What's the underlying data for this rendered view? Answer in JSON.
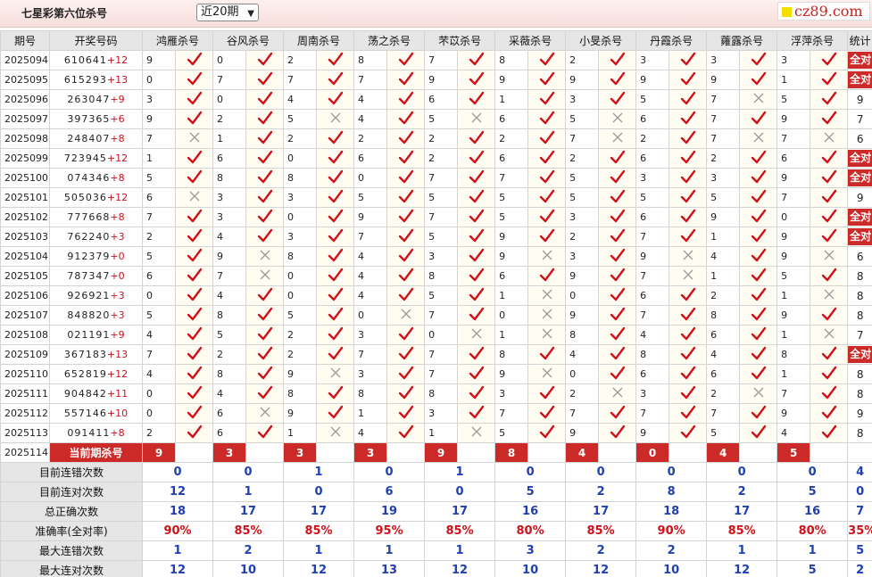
{
  "header": {
    "title": "七星彩第六位杀号",
    "period_selected": "近20期",
    "logo_text": "cz89.com"
  },
  "table": {
    "col_period": "期号",
    "col_draw": "开奖号码",
    "col_stat": "统计",
    "experts": [
      "鸿雁杀号",
      "谷风杀号",
      "周南杀号",
      "荡之杀号",
      "芣苡杀号",
      "采薇杀号",
      "小旻杀号",
      "丹霞杀号",
      "蕹露杀号",
      "浮萍杀号"
    ],
    "rows": [
      {
        "period": "2025094",
        "digits": "610641",
        "sum": "+12",
        "kills": [
          "9",
          "0",
          "2",
          "8",
          "7",
          "8",
          "2",
          "3",
          "3",
          "3"
        ],
        "hits": [
          1,
          1,
          1,
          1,
          1,
          1,
          1,
          1,
          1,
          1
        ],
        "stat": "全对"
      },
      {
        "period": "2025095",
        "digits": "615293",
        "sum": "+13",
        "kills": [
          "0",
          "7",
          "7",
          "7",
          "9",
          "9",
          "9",
          "9",
          "9",
          "1"
        ],
        "hits": [
          1,
          1,
          1,
          1,
          1,
          1,
          1,
          1,
          1,
          1
        ],
        "stat": "全对"
      },
      {
        "period": "2025096",
        "digits": "263047",
        "sum": "+9",
        "kills": [
          "3",
          "0",
          "4",
          "4",
          "6",
          "1",
          "3",
          "5",
          "7",
          "5"
        ],
        "hits": [
          1,
          1,
          1,
          1,
          1,
          1,
          1,
          1,
          0,
          1
        ],
        "stat": "9"
      },
      {
        "period": "2025097",
        "digits": "397365",
        "sum": "+6",
        "kills": [
          "9",
          "2",
          "5",
          "4",
          "5",
          "6",
          "5",
          "6",
          "7",
          "9"
        ],
        "hits": [
          1,
          1,
          0,
          1,
          0,
          1,
          0,
          1,
          1,
          1
        ],
        "stat": "7"
      },
      {
        "period": "2025098",
        "digits": "248407",
        "sum": "+8",
        "kills": [
          "7",
          "1",
          "2",
          "2",
          "2",
          "2",
          "7",
          "2",
          "7",
          "7"
        ],
        "hits": [
          0,
          1,
          1,
          1,
          1,
          1,
          0,
          1,
          0,
          0
        ],
        "stat": "6"
      },
      {
        "period": "2025099",
        "digits": "723945",
        "sum": "+12",
        "kills": [
          "1",
          "6",
          "0",
          "6",
          "2",
          "6",
          "2",
          "6",
          "2",
          "6"
        ],
        "hits": [
          1,
          1,
          1,
          1,
          1,
          1,
          1,
          1,
          1,
          1
        ],
        "stat": "全对"
      },
      {
        "period": "2025100",
        "digits": "074346",
        "sum": "+8",
        "kills": [
          "5",
          "8",
          "8",
          "0",
          "7",
          "7",
          "5",
          "3",
          "3",
          "9"
        ],
        "hits": [
          1,
          1,
          1,
          1,
          1,
          1,
          1,
          1,
          1,
          1
        ],
        "stat": "全对"
      },
      {
        "period": "2025101",
        "digits": "505036",
        "sum": "+12",
        "kills": [
          "6",
          "3",
          "3",
          "5",
          "5",
          "5",
          "5",
          "5",
          "5",
          "7"
        ],
        "hits": [
          0,
          1,
          1,
          1,
          1,
          1,
          1,
          1,
          1,
          1
        ],
        "stat": "9"
      },
      {
        "period": "2025102",
        "digits": "777668",
        "sum": "+8",
        "kills": [
          "7",
          "3",
          "0",
          "9",
          "7",
          "5",
          "3",
          "6",
          "9",
          "0"
        ],
        "hits": [
          1,
          1,
          1,
          1,
          1,
          1,
          1,
          1,
          1,
          1
        ],
        "stat": "全对"
      },
      {
        "period": "2025103",
        "digits": "762240",
        "sum": "+3",
        "kills": [
          "2",
          "4",
          "3",
          "7",
          "5",
          "9",
          "2",
          "7",
          "1",
          "9"
        ],
        "hits": [
          1,
          1,
          1,
          1,
          1,
          1,
          1,
          1,
          1,
          1
        ],
        "stat": "全对"
      },
      {
        "period": "2025104",
        "digits": "912379",
        "sum": "+0",
        "kills": [
          "5",
          "9",
          "8",
          "4",
          "3",
          "9",
          "3",
          "9",
          "4",
          "9"
        ],
        "hits": [
          1,
          0,
          1,
          1,
          1,
          0,
          1,
          0,
          1,
          0
        ],
        "stat": "6"
      },
      {
        "period": "2025105",
        "digits": "787347",
        "sum": "+0",
        "kills": [
          "6",
          "7",
          "0",
          "4",
          "8",
          "6",
          "9",
          "7",
          "1",
          "5"
        ],
        "hits": [
          1,
          0,
          1,
          1,
          1,
          1,
          1,
          0,
          1,
          1
        ],
        "stat": "8"
      },
      {
        "period": "2025106",
        "digits": "926921",
        "sum": "+3",
        "kills": [
          "0",
          "4",
          "0",
          "4",
          "5",
          "1",
          "0",
          "6",
          "2",
          "1"
        ],
        "hits": [
          1,
          1,
          1,
          1,
          1,
          0,
          1,
          1,
          1,
          0
        ],
        "stat": "8"
      },
      {
        "period": "2025107",
        "digits": "848820",
        "sum": "+3",
        "kills": [
          "5",
          "8",
          "5",
          "0",
          "7",
          "0",
          "9",
          "7",
          "8",
          "9"
        ],
        "hits": [
          1,
          1,
          1,
          0,
          1,
          0,
          1,
          1,
          1,
          1
        ],
        "stat": "8"
      },
      {
        "period": "2025108",
        "digits": "021191",
        "sum": "+9",
        "kills": [
          "4",
          "5",
          "2",
          "3",
          "0",
          "1",
          "8",
          "4",
          "6",
          "1"
        ],
        "hits": [
          1,
          1,
          1,
          1,
          0,
          0,
          1,
          1,
          1,
          0
        ],
        "stat": "7"
      },
      {
        "period": "2025109",
        "digits": "367183",
        "sum": "+13",
        "kills": [
          "7",
          "2",
          "2",
          "7",
          "7",
          "8",
          "4",
          "8",
          "4",
          "8"
        ],
        "hits": [
          1,
          1,
          1,
          1,
          1,
          1,
          1,
          1,
          1,
          1
        ],
        "stat": "全对"
      },
      {
        "period": "2025110",
        "digits": "652819",
        "sum": "+12",
        "kills": [
          "4",
          "8",
          "9",
          "3",
          "7",
          "9",
          "0",
          "6",
          "6",
          "1"
        ],
        "hits": [
          1,
          1,
          0,
          1,
          1,
          0,
          1,
          1,
          1,
          1
        ],
        "stat": "8"
      },
      {
        "period": "2025111",
        "digits": "904842",
        "sum": "+11",
        "kills": [
          "0",
          "4",
          "8",
          "8",
          "8",
          "3",
          "2",
          "3",
          "2",
          "7"
        ],
        "hits": [
          1,
          1,
          1,
          1,
          1,
          1,
          0,
          1,
          0,
          1
        ],
        "stat": "8"
      },
      {
        "period": "2025112",
        "digits": "557146",
        "sum": "+10",
        "kills": [
          "0",
          "6",
          "9",
          "1",
          "3",
          "7",
          "7",
          "7",
          "7",
          "9"
        ],
        "hits": [
          1,
          0,
          1,
          1,
          1,
          1,
          1,
          1,
          1,
          1
        ],
        "stat": "9"
      },
      {
        "period": "2025113",
        "digits": "091411",
        "sum": "+8",
        "kills": [
          "2",
          "6",
          "1",
          "4",
          "1",
          "5",
          "9",
          "9",
          "5",
          "4"
        ],
        "hits": [
          1,
          1,
          0,
          1,
          0,
          1,
          1,
          1,
          1,
          1
        ],
        "stat": "8"
      }
    ],
    "current": {
      "period": "2025114",
      "label": "当前期杀号",
      "kills": [
        "9",
        "3",
        "3",
        "3",
        "9",
        "8",
        "4",
        "0",
        "4",
        "5"
      ]
    },
    "summary": [
      {
        "label": "目前连错次数",
        "values": [
          "0",
          "0",
          "1",
          "0",
          "1",
          "0",
          "0",
          "0",
          "0",
          "0"
        ],
        "stat": "4"
      },
      {
        "label": "目前连对次数",
        "values": [
          "12",
          "1",
          "0",
          "6",
          "0",
          "5",
          "2",
          "8",
          "2",
          "5"
        ],
        "stat": "0"
      },
      {
        "label": "总正确次数",
        "values": [
          "18",
          "17",
          "17",
          "19",
          "17",
          "16",
          "17",
          "18",
          "17",
          "16"
        ],
        "stat": "7"
      },
      {
        "label": "准确率(全对率)",
        "values": [
          "90%",
          "85%",
          "85%",
          "95%",
          "85%",
          "80%",
          "85%",
          "90%",
          "85%",
          "80%"
        ],
        "stat": "35%",
        "pct": true
      },
      {
        "label": "最大连错次数",
        "values": [
          "1",
          "2",
          "1",
          "1",
          "1",
          "3",
          "2",
          "2",
          "1",
          "1"
        ],
        "stat": "5"
      },
      {
        "label": "最大连对次数",
        "values": [
          "12",
          "10",
          "12",
          "13",
          "12",
          "10",
          "12",
          "10",
          "12",
          "5"
        ],
        "stat": "2"
      }
    ]
  },
  "icons": {
    "hit": "check-icon",
    "miss": "cross-icon"
  },
  "colors": {
    "accent_red": "#cb2a28",
    "check_red": "#d0111a",
    "cross_gray": "#9a9a9a",
    "summary_blue": "#1f3fb3",
    "header_bg": "#e6e6e6"
  }
}
